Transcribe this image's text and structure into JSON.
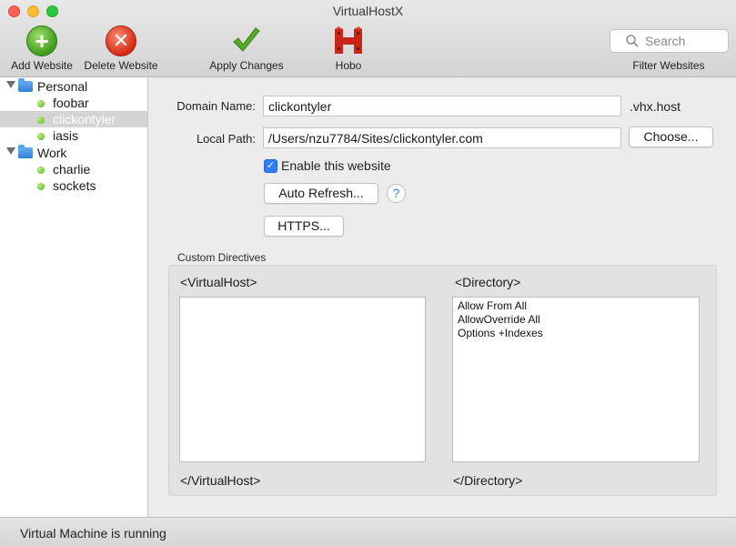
{
  "window": {
    "title": "VirtualHostX"
  },
  "toolbar": {
    "add_label": "Add Website",
    "delete_label": "Delete Website",
    "apply_label": "Apply Changes",
    "hobo_label": "Hobo",
    "search_placeholder": "Search",
    "filter_label": "Filter Websites"
  },
  "sidebar": {
    "groups": [
      {
        "label": "Personal",
        "sites": [
          "foobar",
          "clickontyler",
          "iasis"
        ]
      },
      {
        "label": "Work",
        "sites": [
          "charlie",
          "sockets"
        ]
      }
    ],
    "selected": "clickontyler"
  },
  "form": {
    "domain_label": "Domain Name:",
    "domain_value": "clickontyler",
    "domain_suffix": ".vhx.host",
    "path_label": "Local Path:",
    "path_value": "/Users/nzu7784/Sites/clickontyler.com",
    "choose_label": "Choose...",
    "enable_label": "Enable this website",
    "enable_checked": true,
    "auto_refresh_label": "Auto Refresh...",
    "help_glyph": "?",
    "https_label": "HTTPS..."
  },
  "directives": {
    "title": "Custom Directives",
    "vhost_open": "<VirtualHost>",
    "vhost_close": "</VirtualHost>",
    "vhost_content": "",
    "dir_open": "<Directory>",
    "dir_close": "</Directory>",
    "dir_content": "Allow From All\nAllowOverride All\nOptions +Indexes"
  },
  "status": {
    "text": "Virtual Machine is running"
  },
  "icons": {
    "add": "plus-circle-icon",
    "delete": "x-circle-icon",
    "apply": "checkmark-icon",
    "hobo": "hobo-icon",
    "search": "magnifier-icon"
  },
  "colors": {
    "accent": "#2f7ef6",
    "add_green": "#3f9a1c",
    "delete_red": "#d42a14",
    "hobo_red": "#c8261b",
    "status_dot": "#56b21c"
  }
}
